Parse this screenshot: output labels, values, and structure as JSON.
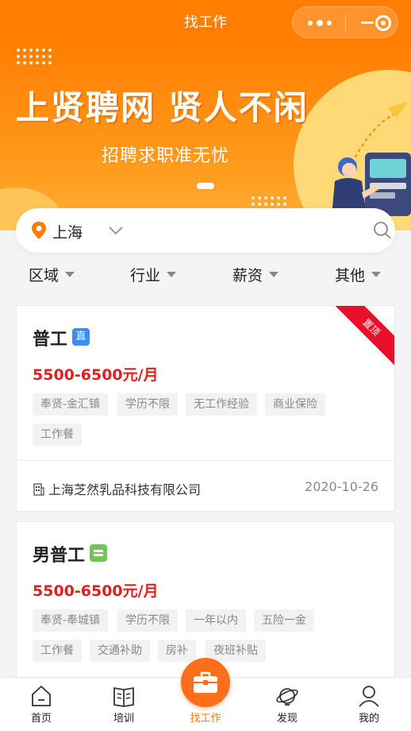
{
  "header": {
    "title": "找工作"
  },
  "banner": {
    "headline": "上贤聘网  贤人不闲",
    "subline": "招聘求职准无忧"
  },
  "search": {
    "city": "上海"
  },
  "filters": [
    "区域",
    "行业",
    "薪资",
    "其他"
  ],
  "jobs": [
    {
      "title": "普工",
      "badge": "直",
      "salary": "5500-6500元/月",
      "tags": [
        "奉贤-金汇镇",
        "学历不限",
        "无工作经验",
        "商业保险",
        "工作餐"
      ],
      "company": "上海芝然乳品科技有限公司",
      "date": "2020-10-26",
      "corner": "置顶"
    },
    {
      "title": "男普工",
      "salary": "5500-6500元/月",
      "tags": [
        "奉贤-奉城镇",
        "学历不限",
        "一年以内",
        "五险一金",
        "工作餐",
        "交通补助",
        "房补",
        "夜班补贴"
      ]
    }
  ],
  "tabbar": [
    {
      "label": "首页",
      "icon": "home-icon"
    },
    {
      "label": "培训",
      "icon": "book-icon"
    },
    {
      "label": "找工作",
      "icon": "briefcase-icon",
      "active": true
    },
    {
      "label": "发现",
      "icon": "planet-icon"
    },
    {
      "label": "我的",
      "icon": "user-icon"
    }
  ],
  "colors": {
    "brand": "#ff7d00",
    "salary": "#e02020",
    "top_ribbon": "#e8102a",
    "active_tab": "#ff7d00"
  }
}
